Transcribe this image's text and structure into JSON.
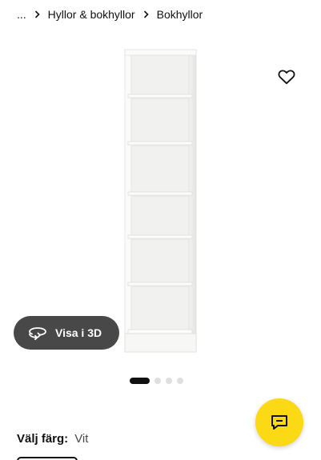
{
  "breadcrumb": {
    "ellipsis": "...",
    "items": [
      "Hyllor & bokhyllor",
      "Bokhyllor"
    ]
  },
  "buttons": {
    "view3d_label": "Visa i 3D"
  },
  "gallery": {
    "image_count": 4,
    "active_index": 0
  },
  "color_selector": {
    "label": "Välj färg:",
    "value": "Vit"
  },
  "icons": {
    "favorite": "heart-outline-icon",
    "view3d": "rotate-3d-icon",
    "chat": "chat-bubble-icon",
    "separator": "chevron-right-icon"
  },
  "colors": {
    "accent": "#fbd914",
    "dark_button": "#484848",
    "text": "#111111",
    "dot_inactive": "#dfdfdf"
  }
}
